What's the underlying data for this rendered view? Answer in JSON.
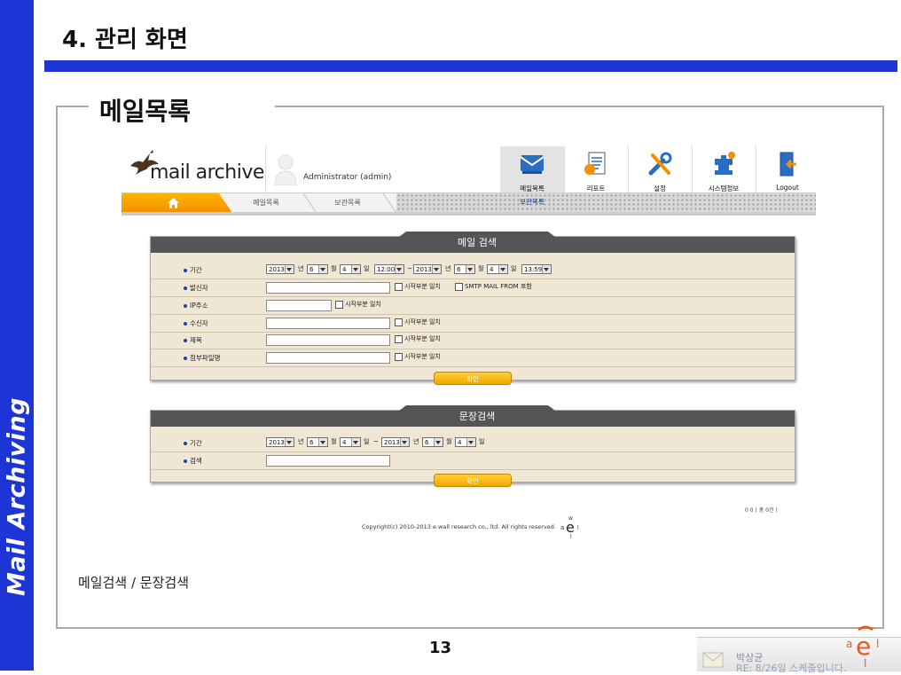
{
  "slide": {
    "sidebar_text": "Mail Archiving",
    "title": "4. 관리 화면",
    "section_title": "메일목록",
    "caption": "메일검색 / 문장검색",
    "page_number": "13"
  },
  "app": {
    "logo_text": "mail archive",
    "user": "Administrator (admin)",
    "top_nav": [
      {
        "label": "메일목록",
        "icon": "mail-list-icon",
        "active": true
      },
      {
        "label": "리포트",
        "icon": "report-icon",
        "active": false
      },
      {
        "label": "설정",
        "icon": "settings-tools-icon",
        "active": false
      },
      {
        "label": "시스템정보",
        "icon": "system-info-icon",
        "active": false
      },
      {
        "label": "Logout",
        "icon": "logout-door-icon",
        "active": false
      }
    ],
    "sub_nav_label": "보관목록",
    "tabs": [
      "메일목록",
      "보관목록"
    ],
    "home_icon": "home-icon",
    "mail_search": {
      "title": "메일 검색",
      "period_label": "기간",
      "from_year": "2013",
      "from_year_unit": "년",
      "from_month": "6",
      "from_month_unit": "월",
      "from_day": "4",
      "from_day_unit": "일",
      "from_time": "12:00",
      "tilde": "~",
      "to_year": "2013",
      "to_year_unit": "년",
      "to_month": "6",
      "to_month_unit": "월",
      "to_day": "4",
      "to_day_unit": "일",
      "to_time": "13:59",
      "sender_label": "발신자",
      "ip_label": "IP주소",
      "recipient_label": "수신자",
      "subject_label": "제목",
      "attachment_label": "첨부파일명",
      "starts_with_label": "시작부분 일치",
      "smtp_from_label": "SMTP MAIL FROM 포함",
      "submit_label": "확인"
    },
    "sentence_search": {
      "title": "문장검색",
      "period_label": "기간",
      "from_year": "2013",
      "from_year_unit": "년",
      "from_month": "6",
      "from_month_unit": "월",
      "from_day": "4",
      "from_day_unit": "일",
      "tilde": "~",
      "to_year": "2013",
      "to_year_unit": "년",
      "to_month": "6",
      "to_month_unit": "월",
      "to_day": "4",
      "to_day_unit": "일",
      "search_label": "검색",
      "submit_label": "확인"
    },
    "copyright": "Copyright(c) 2010-2013 e.wall research co., ltd. All rights reserved.",
    "cutoff_text": "0 0 ( 총 0건 )"
  },
  "notification": {
    "name": "박상균",
    "message": "RE: 8/26일 스케줄입니다."
  },
  "colors": {
    "accent_blue": "#1e35d6",
    "header_gray": "#555555",
    "panel_bg": "#efe6d3",
    "button_orange": "#f2a600"
  }
}
